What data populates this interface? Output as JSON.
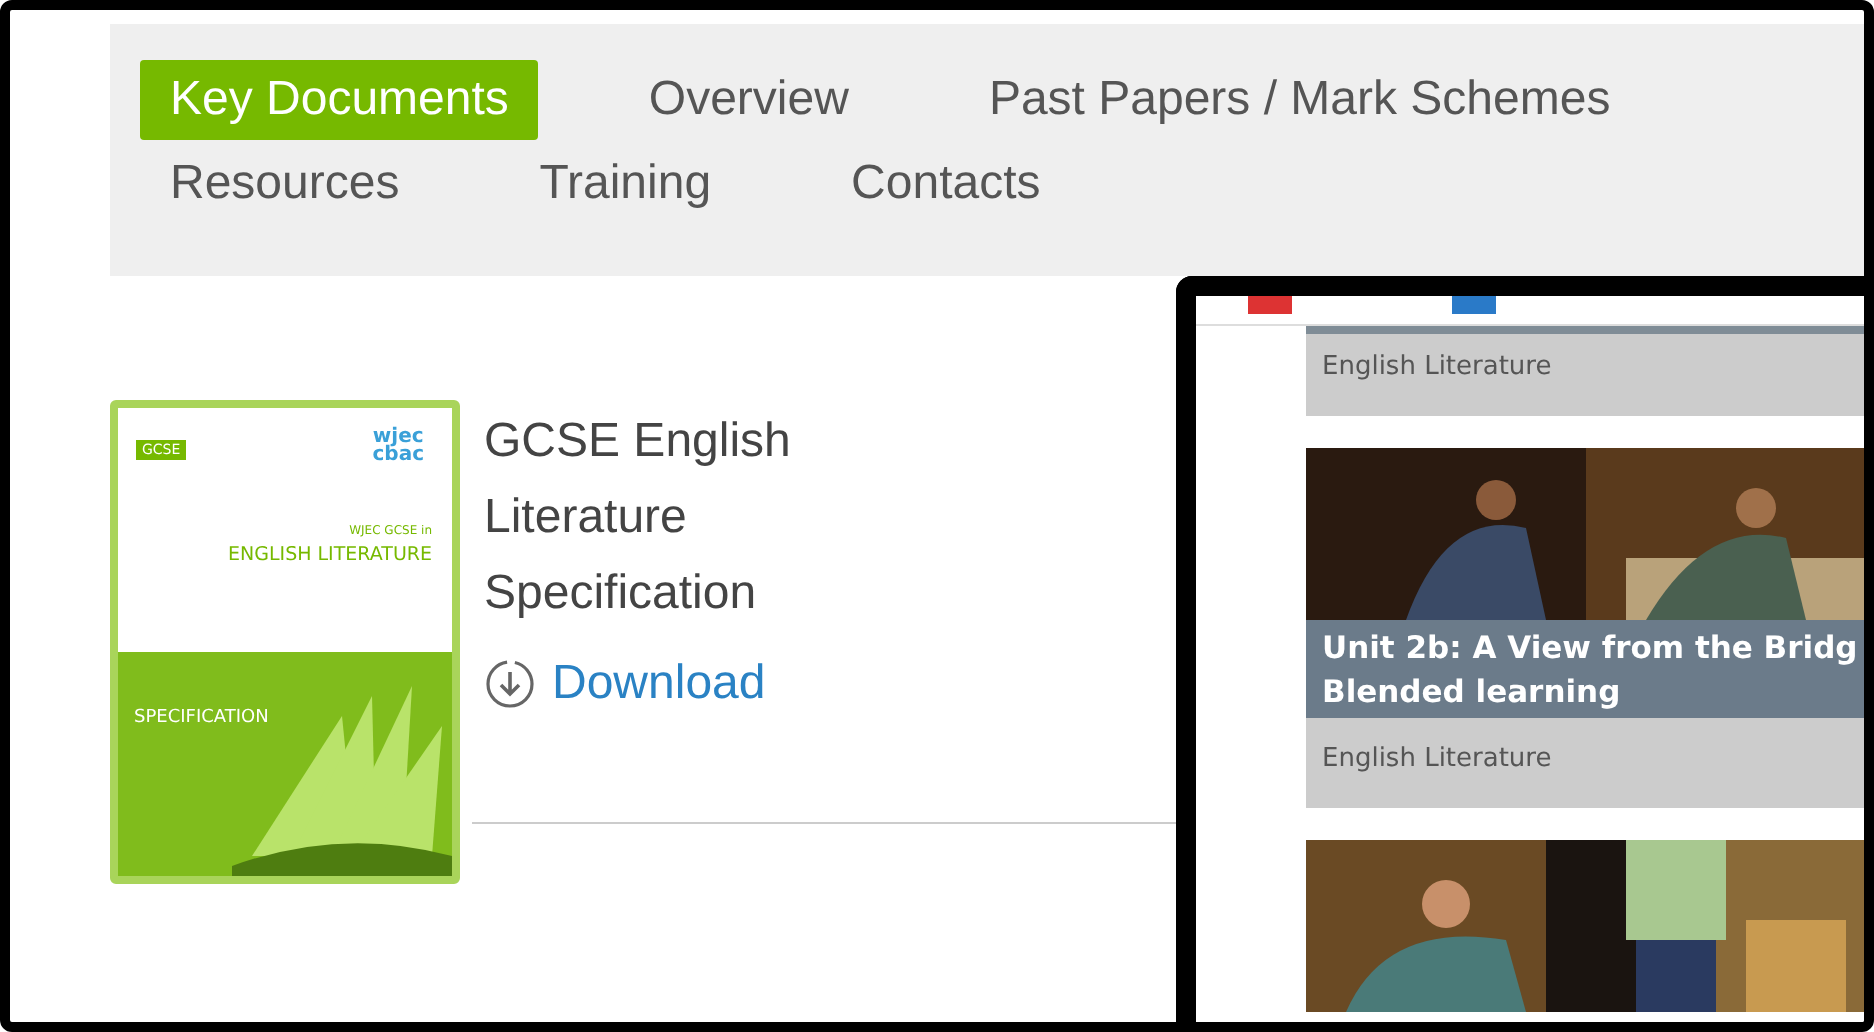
{
  "nav": {
    "tabs": [
      {
        "label": "Key Documents",
        "selected": true
      },
      {
        "label": "Overview",
        "selected": false
      },
      {
        "label": "Past Papers / Mark Schemes",
        "selected": false
      },
      {
        "label": "Resources",
        "selected": false
      },
      {
        "label": "Training",
        "selected": false
      },
      {
        "label": "Contacts",
        "selected": false
      }
    ]
  },
  "document": {
    "cover": {
      "badge": "GCSE",
      "logo_top": "wjec",
      "logo_bottom": "cbac",
      "subtitle": "WJEC GCSE in",
      "title": "ENGLISH LITERATURE",
      "label": "SPECIFICATION"
    },
    "title": "GCSE English Literature Specification",
    "download": "Download"
  },
  "overlay": {
    "cards": [
      {
        "kind": "subject",
        "subject": "English Literature"
      },
      {
        "kind": "full",
        "title_lines": [
          "Unit 2b: A View from the Bridg",
          "Blended learning"
        ],
        "subject": "English Literature"
      },
      {
        "kind": "picture"
      }
    ]
  }
}
